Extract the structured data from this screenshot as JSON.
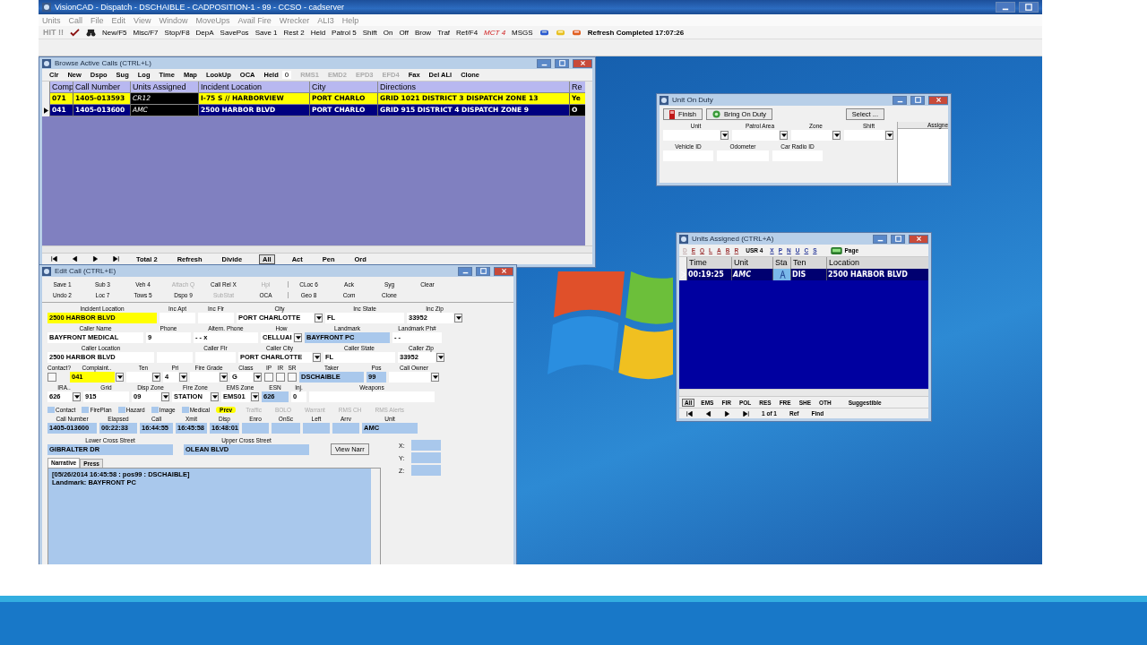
{
  "app": {
    "title": "VisionCAD - Dispatch - DSCHAIBLE - CADPOSITION-1 - 99 - CCSO - cadserver",
    "menu": [
      "Units",
      "Call",
      "File",
      "Edit",
      "View",
      "Window",
      "MoveUps",
      "Avail Fire",
      "Wrecker",
      "ALI3",
      "Help"
    ],
    "toolbar": {
      "hit": "HIT !!",
      "buttons": [
        {
          "label": "New/F5",
          "alert": false
        },
        {
          "label": "Misc/F7",
          "alert": false
        },
        {
          "label": "Stop/F8",
          "alert": false
        },
        {
          "label": "DepA",
          "alert": false
        },
        {
          "label": "SavePos",
          "alert": false
        },
        {
          "label": "Save 1",
          "alert": false
        },
        {
          "label": "Rest 2",
          "alert": false
        },
        {
          "label": "Held",
          "alert": false
        },
        {
          "label": "Patrol 5",
          "alert": false
        },
        {
          "label": "Shift",
          "alert": false
        },
        {
          "label": "On",
          "alert": false
        },
        {
          "label": "Off",
          "alert": false
        },
        {
          "label": "Brow",
          "alert": false
        },
        {
          "label": "Traf",
          "alert": false
        },
        {
          "label": "Ref/F4",
          "alert": false
        },
        {
          "label": "MCT 4",
          "alert": true
        },
        {
          "label": "MSGS",
          "alert": false
        }
      ],
      "status": "Refresh Completed 17:07:26"
    }
  },
  "browse_calls": {
    "title": "Browse Active Calls (CTRL+L)",
    "toolbar": [
      {
        "kind": "button",
        "label": "Clr",
        "disabled": false
      },
      {
        "kind": "button",
        "label": "New",
        "disabled": false
      },
      {
        "kind": "button",
        "label": "Dspo",
        "disabled": false
      },
      {
        "kind": "button",
        "label": "Sug",
        "disabled": false
      },
      {
        "kind": "button",
        "label": "Log",
        "disabled": false
      },
      {
        "kind": "button",
        "label": "Time",
        "disabled": false
      },
      {
        "kind": "button",
        "label": "Map",
        "disabled": false
      },
      {
        "kind": "button",
        "label": "LookUp",
        "disabled": false
      },
      {
        "kind": "button",
        "label": "OCA",
        "disabled": false
      },
      {
        "kind": "button",
        "label": "Held",
        "disabled": false
      },
      {
        "kind": "counter",
        "label": "0",
        "disabled": false
      },
      {
        "kind": "button",
        "label": "RMS1",
        "disabled": true
      },
      {
        "kind": "button",
        "label": "EMD2",
        "disabled": true
      },
      {
        "kind": "button",
        "label": "EPD3",
        "disabled": true
      },
      {
        "kind": "button",
        "label": "EFD4",
        "disabled": true
      },
      {
        "kind": "button",
        "label": "Fax",
        "disabled": false
      },
      {
        "kind": "button",
        "label": "Del ALl",
        "disabled": false
      },
      {
        "kind": "button",
        "label": "Clone",
        "disabled": false
      }
    ],
    "columns": [
      "Comp",
      "Call Number",
      "Units Assigned",
      "Incident Location",
      "City",
      "Directions",
      "Re"
    ],
    "rows": [
      {
        "selected": false,
        "color": "#ffff00",
        "cells": [
          "071",
          "1405-013593",
          "CR12",
          "I-75 S // HARBORVIEW",
          "PORT CHARLO",
          "GRID 1021 DISTRICT 3 DISPATCH ZONE 13",
          "Ye"
        ]
      },
      {
        "selected": true,
        "color": "#000080",
        "cells": [
          "041",
          "1405-013600",
          "AMC",
          "2500 HARBOR BLVD",
          "PORT CHARLO",
          "GRID 915 DISTRICT 4 DISPATCH ZONE 9",
          "O"
        ]
      }
    ],
    "footer": [
      {
        "label": "Total 2",
        "selected": false
      },
      {
        "label": "Refresh",
        "selected": false
      },
      {
        "label": "Divide",
        "selected": false
      },
      {
        "label": "All",
        "selected": true
      },
      {
        "label": "Act",
        "selected": false
      },
      {
        "label": "Pen",
        "selected": false
      },
      {
        "label": "Ord",
        "selected": false
      }
    ]
  },
  "edit_call": {
    "title": "Edit Call (CTRL+E)",
    "toolbar": [
      [
        {
          "label": "Save 1",
          "disabled": false
        },
        {
          "label": "Sub 3",
          "disabled": false
        },
        {
          "label": "Veh 4",
          "disabled": false
        },
        {
          "label": "Attach Q",
          "disabled": true
        },
        {
          "label": "Call Rel X",
          "disabled": false
        },
        {
          "label": "Hpl",
          "disabled": true
        },
        {
          "label": "CLoc 6",
          "disabled": false
        },
        {
          "label": "Ack",
          "disabled": false
        },
        {
          "label": "Syg",
          "disabled": false
        },
        {
          "label": "Clear",
          "disabled": false
        }
      ],
      [
        {
          "label": "Undo 2",
          "disabled": false
        },
        {
          "label": "Loc 7",
          "disabled": false
        },
        {
          "label": "Tows 5",
          "disabled": false
        },
        {
          "label": "Dspo 9",
          "disabled": false
        },
        {
          "label": "SubStat",
          "disabled": true
        },
        {
          "label": "OCA",
          "disabled": false
        },
        {
          "label": "Geo 8",
          "disabled": false
        },
        {
          "label": "Com",
          "disabled": false
        },
        {
          "label": "Clone",
          "disabled": false
        }
      ]
    ],
    "form": [
      [
        {
          "kind": "highlighted",
          "label": "Incident Location",
          "value": "2500 HARBOR BLVD",
          "dropdown": false
        },
        {
          "kind": "plain",
          "label": "Inc Apt",
          "dropdown": false
        },
        {
          "kind": "plain",
          "label": "Inc Flr",
          "dropdown": false
        },
        {
          "kind": "plain",
          "label": "City",
          "value": "PORT CHARLOTTE",
          "dropdown": true
        },
        {
          "kind": "plain",
          "label": "Inc State",
          "value": "FL",
          "dropdown": false
        },
        {
          "kind": "plain",
          "label": "Inc Zip",
          "value": "33952",
          "dropdown": true
        }
      ],
      [
        {
          "kind": "plain",
          "label": "Caller Name",
          "value": "BAYFRONT MEDICAL",
          "dropdown": false
        },
        {
          "kind": "plain",
          "label": "Phone",
          "value": "9",
          "dropdown": false
        },
        {
          "kind": "plain",
          "label": "Altern. Phone",
          "value": "-  -    x",
          "dropdown": false
        },
        {
          "kind": "plain",
          "label": "How",
          "value": "CELLUAI",
          "dropdown": true
        },
        {
          "kind": "readonly",
          "label": "Landmark",
          "value": "BAYFRONT PC",
          "dropdown": false
        },
        {
          "kind": "plain",
          "label": "Landmark Ph#",
          "value": "-  -",
          "dropdown": false
        }
      ],
      [
        {
          "kind": "plain",
          "label": "Caller Location",
          "value": "2500 HARBOR BLVD",
          "dropdown": false
        },
        {
          "kind": "plain",
          "dropdown": false
        },
        {
          "kind": "plain",
          "label": "Caller Flr",
          "dropdown": false
        },
        {
          "kind": "plain",
          "label": "Caller City",
          "value": "PORT CHARLOTTE",
          "dropdown": true
        },
        {
          "kind": "plain",
          "label": "Caller State",
          "value": "FL",
          "dropdown": false
        },
        {
          "kind": "plain",
          "label": "Caller Zip",
          "value": "33952",
          "dropdown": true
        }
      ],
      [
        {
          "kind": "checkbox",
          "label": "Contact?",
          "checked": false
        },
        {
          "kind": "highlighted",
          "label": "Complaint..",
          "value": "041",
          "dropdown": true
        },
        {
          "kind": "plain",
          "label": "Ten",
          "dropdown": true
        },
        {
          "kind": "plain",
          "label": "Pri",
          "value": "4",
          "dropdown": true
        },
        {
          "kind": "plain",
          "label": "Fire Grade",
          "dropdown": true
        },
        {
          "kind": "plain",
          "label": "Class",
          "value": "G",
          "dropdown": true
        },
        {
          "kind": "checkbox",
          "label": "IP",
          "checked": false
        },
        {
          "kind": "checkbox",
          "label": "IR",
          "checked": false
        },
        {
          "kind": "checkbox",
          "label": "SR",
          "checked": false
        },
        {
          "kind": "readonly",
          "label": "Taker",
          "value": "DSCHAIBLE",
          "dropdown": false
        },
        {
          "kind": "readonly",
          "label": "Pos",
          "value": "99",
          "dropdown": false
        },
        {
          "kind": "plain",
          "label": "Call Owner",
          "dropdown": true
        }
      ],
      [
        {
          "kind": "plain",
          "label": "IRA..",
          "value": "626",
          "dropdown": true
        },
        {
          "kind": "plain",
          "label": "Grid",
          "value": "915",
          "dropdown": false
        },
        {
          "kind": "plain",
          "label": "Disp Zone",
          "value": "09",
          "dropdown": true
        },
        {
          "kind": "plain",
          "label": "Fire Zone",
          "value": "STATION",
          "dropdown": true
        },
        {
          "kind": "plain",
          "label": "EMS Zone",
          "value": "EMS01",
          "dropdown": true
        },
        {
          "kind": "readonly",
          "label": "ESN",
          "value": "626",
          "dropdown": false
        },
        {
          "kind": "plain",
          "label": "Inj.",
          "value": "0",
          "dropdown": false
        },
        {
          "kind": "plain",
          "label": "Weapons",
          "dropdown": false
        }
      ]
    ],
    "flags": [
      {
        "kind": "flag",
        "label": "Contact",
        "active": false
      },
      {
        "kind": "flag",
        "label": "FirePlan",
        "active": false
      },
      {
        "kind": "flag",
        "label": "Hazard",
        "active": false
      },
      {
        "kind": "flag",
        "label": "Image",
        "active": false
      },
      {
        "kind": "flag",
        "label": "Medical",
        "active": false
      },
      {
        "kind": "link",
        "label": "Prev",
        "active": true
      },
      {
        "kind": "link",
        "label": "Traffic",
        "active": false
      },
      {
        "kind": "link",
        "label": "BOLO",
        "active": false
      },
      {
        "kind": "link",
        "label": "Warrant",
        "active": false
      },
      {
        "kind": "link",
        "label": "RMS CH",
        "active": false
      },
      {
        "kind": "link",
        "label": "RMS Alerts",
        "active": false
      }
    ],
    "times": [
      {
        "label": "Call Number",
        "value": "1405-013600"
      },
      {
        "label": "Elapsed",
        "value": "00:22:33"
      },
      {
        "label": "Call",
        "value": "16:44:55"
      },
      {
        "label": "Xmit",
        "value": "16:45:58"
      },
      {
        "label": "Disp",
        "value": "16:48:01"
      },
      {
        "label": "Enro"
      },
      {
        "label": "OnSc"
      },
      {
        "label": "Left"
      },
      {
        "label": "Arrv"
      },
      {
        "label": "Unit",
        "value": "AMC"
      }
    ],
    "cross_streets": [
      {
        "label": "Lower Cross Street",
        "value": "GIBRALTER DR"
      },
      {
        "label": "Upper Cross Street",
        "value": "OLEAN BLVD"
      }
    ],
    "view_button": "View Narr",
    "coords": [
      {
        "label": "X:"
      },
      {
        "label": "Y:"
      },
      {
        "label": "Z:"
      }
    ],
    "tabs": [
      {
        "label": "Narrative",
        "selected": true
      },
      {
        "label": "Press",
        "selected": false
      }
    ],
    "narrative": [
      "[05/26/2014 16:45:58 : pos99 : DSCHAIBLE]",
      "Landmark: BAYFRONT PC"
    ]
  },
  "unit_on_duty": {
    "title": "Unit On Duty",
    "buttons": [
      {
        "kind": "finish",
        "label": "Finish"
      },
      {
        "kind": "duty",
        "label": "Bring On Duty"
      }
    ],
    "select_button": "Select ...",
    "dropdowns": [
      "Unit",
      "Patrol Area",
      "Zone",
      "Shift"
    ],
    "inputs": [
      "Vehicle ID",
      "Odometer",
      "Car Radio ID"
    ],
    "list_header": "Assigne"
  },
  "units_assigned": {
    "title": "Units Assigned (CTRL+A)",
    "call_letters": [
      {
        "label": "D",
        "disabled": true
      },
      {
        "label": "E",
        "disabled": false
      },
      {
        "label": "Q",
        "disabled": false
      },
      {
        "label": "L",
        "disabled": false
      },
      {
        "label": "A",
        "disabled": false
      },
      {
        "label": "B",
        "disabled": false
      },
      {
        "label": "R",
        "disabled": false
      }
    ],
    "usr_button": "USR 4",
    "unit_letters": [
      {
        "label": "X",
        "disabled": false
      },
      {
        "label": "P",
        "disabled": false
      },
      {
        "label": "N",
        "disabled": false
      },
      {
        "label": "U",
        "disabled": false
      },
      {
        "label": "C",
        "disabled": false
      },
      {
        "label": "S",
        "disabled": false
      }
    ],
    "page_button": "Page",
    "columns": [
      "Time",
      "Unit",
      "Sta",
      "Ten",
      "Location"
    ],
    "rows": [
      {
        "selected": true,
        "time": "00:19:25",
        "unit": "AMC",
        "ten": "DIS",
        "location": "2500 HARBOR BLVD"
      }
    ],
    "filters": [
      {
        "label": "All",
        "selected": true
      },
      {
        "label": "EMS",
        "selected": false
      },
      {
        "label": "FIR",
        "selected": false
      },
      {
        "label": "POL",
        "selected": false
      },
      {
        "label": "RES",
        "selected": false
      },
      {
        "label": "FRE",
        "selected": false
      },
      {
        "label": "SHE",
        "selected": false
      },
      {
        "label": "OTH",
        "selected": false
      }
    ],
    "suggest_button": "Suggestible",
    "page_count": "1 of 1",
    "nav_buttons": [
      "Ref",
      "Find"
    ]
  }
}
